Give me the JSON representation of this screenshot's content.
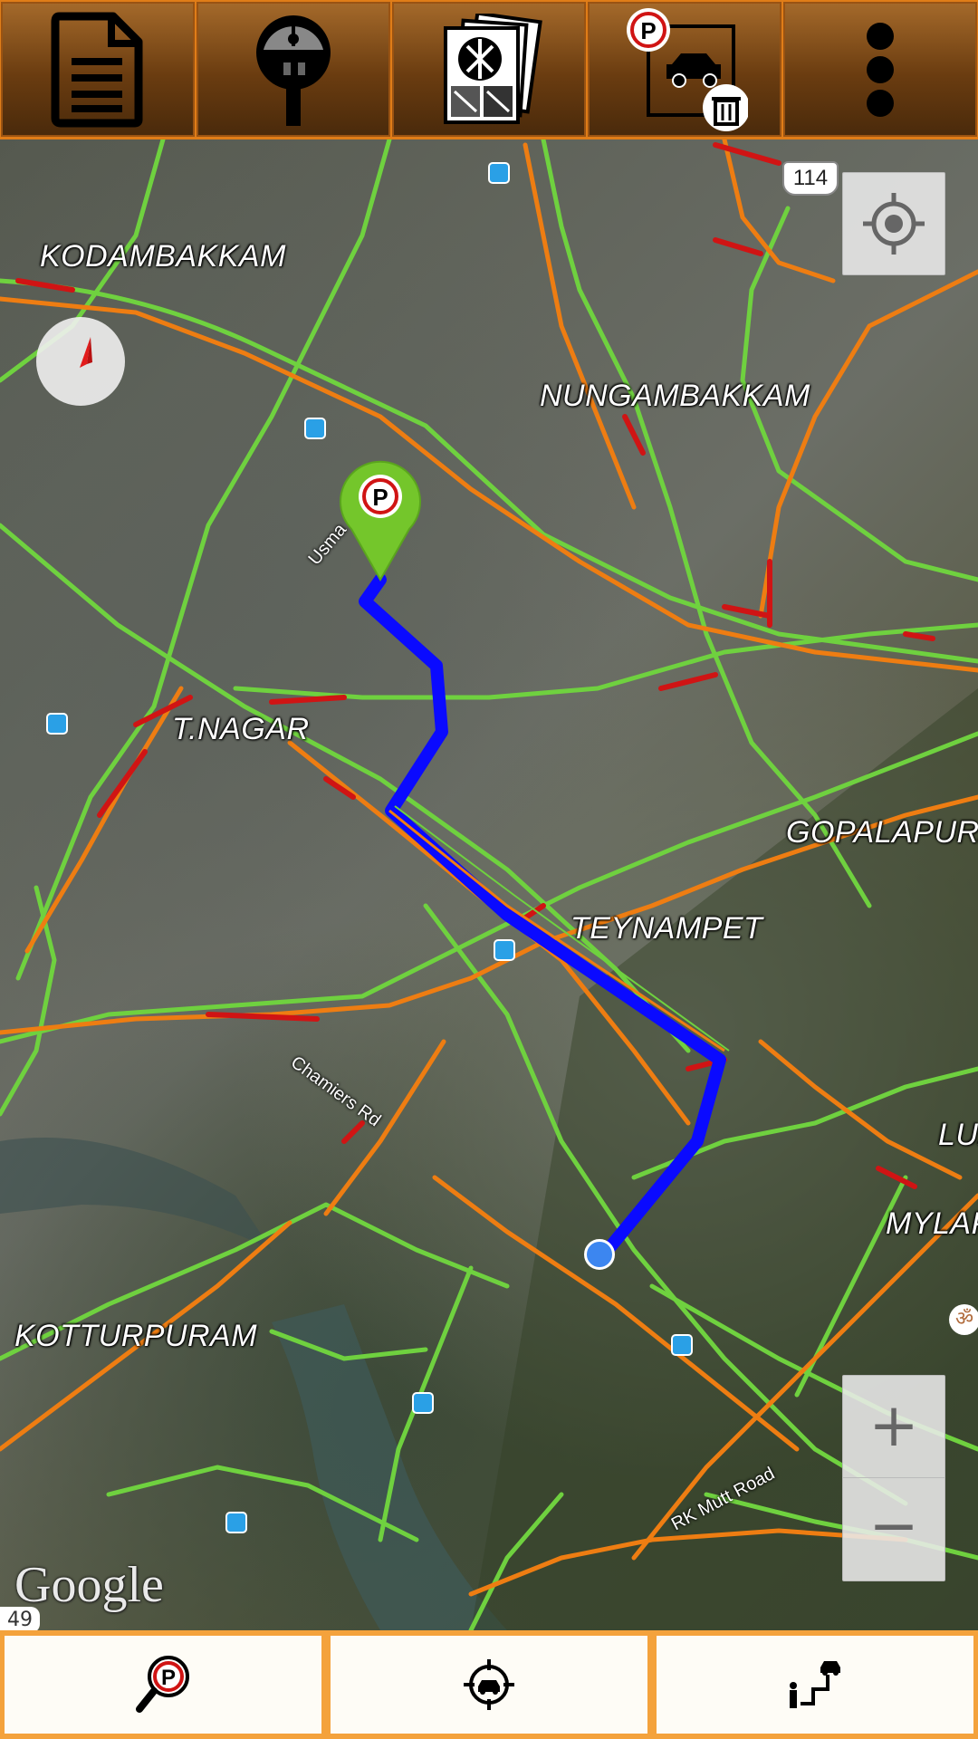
{
  "toolbar_top": {
    "buttons": [
      {
        "name": "notes",
        "icon": "document-icon"
      },
      {
        "name": "parking-meter",
        "icon": "parking-meter-icon"
      },
      {
        "name": "map-layers",
        "icon": "map-stack-icon"
      },
      {
        "name": "clear-parked-car",
        "icon": "parked-car-delete-icon"
      },
      {
        "name": "overflow-menu",
        "icon": "more-vert-icon"
      }
    ]
  },
  "map": {
    "places": [
      {
        "id": "kodambakkam",
        "label": "KODAMBAKKAM"
      },
      {
        "id": "nungambakkam",
        "label": "NUNGAMBAKKAM"
      },
      {
        "id": "t-nagar",
        "label": "T.NAGAR"
      },
      {
        "id": "gopalapuram",
        "label": "GOPALAPURA"
      },
      {
        "id": "teynampet",
        "label": "TEYNAMPET"
      },
      {
        "id": "luz",
        "label": "LUZ"
      },
      {
        "id": "mylapore",
        "label": "MYLAPO"
      },
      {
        "id": "kotturpuram",
        "label": "KOTTURPURAM"
      }
    ],
    "roads": [
      {
        "id": "usman-rd",
        "label": "Usma"
      },
      {
        "id": "chamiers-rd",
        "label": "Chamiers Rd"
      },
      {
        "id": "rk-mutt-rd",
        "label": "RK Mutt Road"
      }
    ],
    "highway_114": "114",
    "highway_49": "49",
    "attribution": "Google",
    "zoom_in_label": "+",
    "zoom_out_label": "−",
    "colors": {
      "route": "#0a0aff",
      "traffic_fast": "#6fd13f",
      "traffic_medium": "#ee7d12",
      "traffic_slow": "#d01414",
      "parking_marker": "#74c62b",
      "current_location": "#3c86f0",
      "toolbar_accent": "#e07d18"
    }
  },
  "toolbar_bottom": {
    "buttons": [
      {
        "name": "find-parking",
        "icon": "parking-search-icon"
      },
      {
        "name": "locate-car",
        "icon": "car-target-icon"
      },
      {
        "name": "walk-to-car",
        "icon": "walking-route-icon"
      }
    ]
  }
}
